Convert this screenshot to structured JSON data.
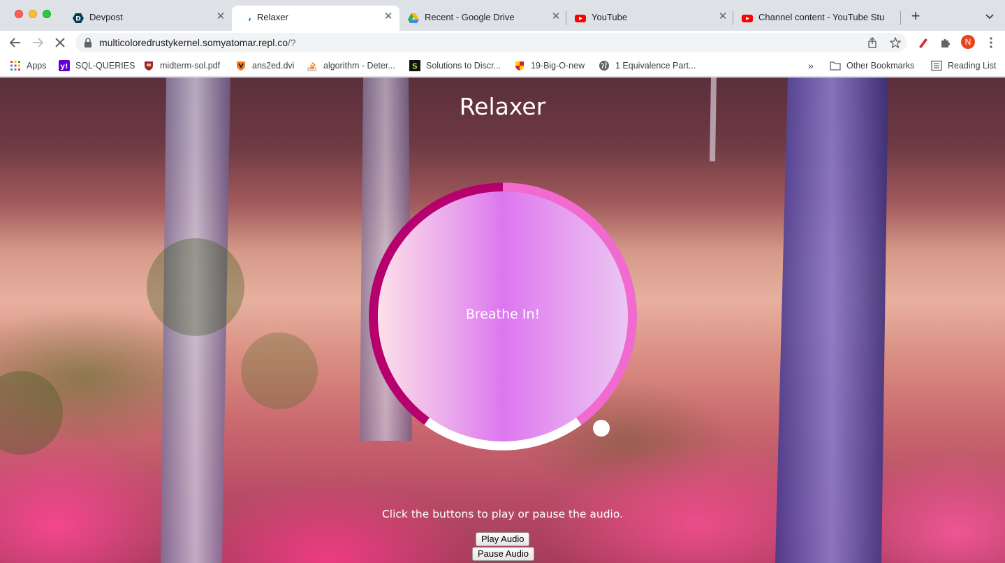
{
  "browser": {
    "tabs": [
      {
        "title": "Devpost",
        "icon": "devpost-icon",
        "active": false
      },
      {
        "title": "Relaxer",
        "icon": "loading-icon",
        "active": true
      },
      {
        "title": "Recent - Google Drive",
        "icon": "google-drive-icon",
        "active": false
      },
      {
        "title": "YouTube",
        "icon": "youtube-icon",
        "active": false
      },
      {
        "title": "Channel content - YouTube Stu",
        "icon": "youtube-icon",
        "active": false
      }
    ],
    "url_main": "multicoloredrustykernel.somyatomar.repl.co",
    "url_path": "/?",
    "profile_initial": "N",
    "bookmarks": [
      {
        "label": "Apps",
        "icon": "apps-grid-icon"
      },
      {
        "label": "SQL-QUERIES",
        "icon": "yahoo-icon"
      },
      {
        "label": "midterm-sol.pdf",
        "icon": "shield-crest-icon"
      },
      {
        "label": "ans2ed.dvi",
        "icon": "shield-crest-icon"
      },
      {
        "label": "algorithm - Deter...",
        "icon": "stackoverflow-icon"
      },
      {
        "label": "Solutions to Discr...",
        "icon": "slader-icon"
      },
      {
        "label": "19-Big-O-new",
        "icon": "umd-icon"
      },
      {
        "label": "1 Equivalence Part...",
        "icon": "globe-icon"
      }
    ],
    "overflow_label": "»",
    "other_bookmarks": "Other Bookmarks",
    "reading_list": "Reading List"
  },
  "page": {
    "title": "Relaxer",
    "breath_text": "Breathe In!",
    "instruction": "Click the buttons to play or pause the audio.",
    "play_label": "Play Audio",
    "pause_label": "Pause Audio"
  },
  "colors": {
    "ring_dark": "#b5006e",
    "ring_light": "#f06ad0",
    "ring_white": "#ffffff",
    "circle_center": "#dd76f0"
  }
}
